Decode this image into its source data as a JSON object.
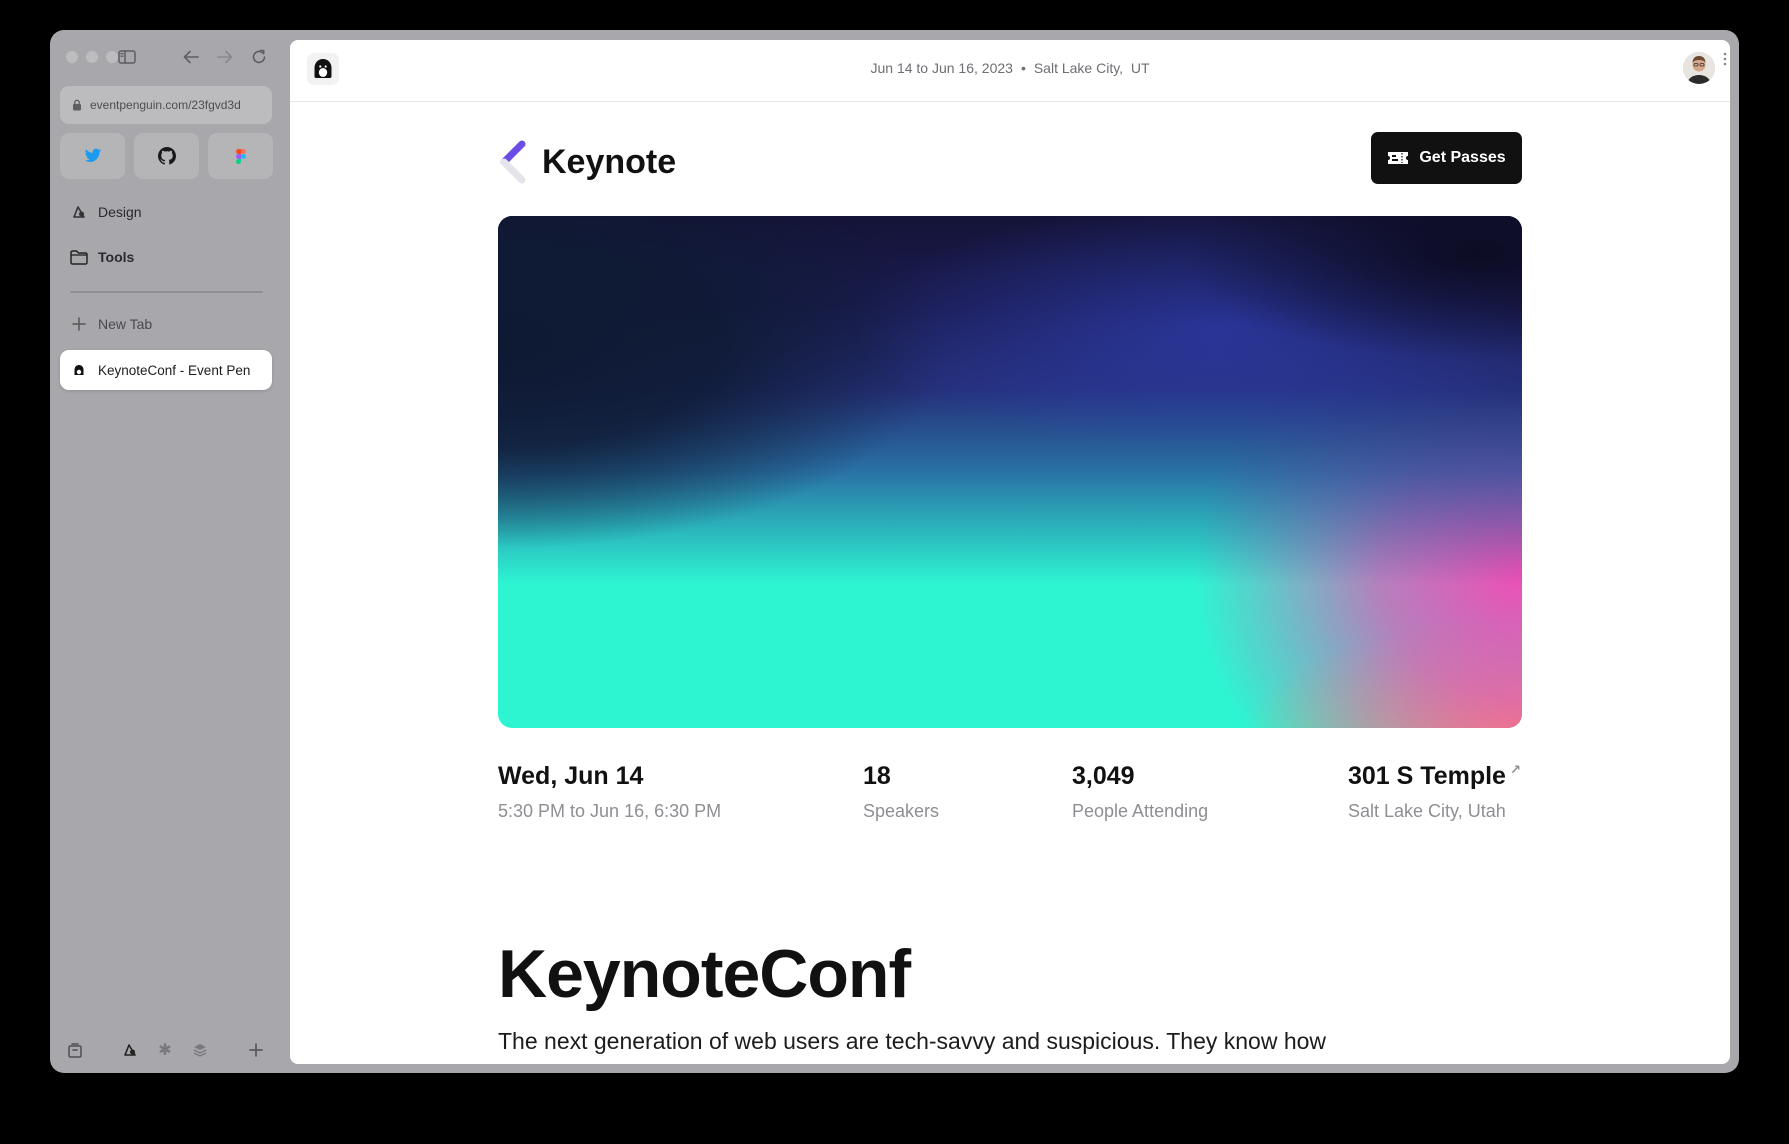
{
  "browser": {
    "url": "eventpenguin.com/23fgvd3d",
    "favorites": [
      {
        "name": "twitter-icon"
      },
      {
        "name": "github-icon"
      },
      {
        "name": "figma-icon"
      }
    ],
    "sidebar_items": [
      {
        "label": "Design",
        "icon": "design-icon"
      },
      {
        "label": "Tools",
        "icon": "folder-icon"
      }
    ],
    "new_tab_label": "New Tab",
    "active_tab_label": "KeynoteConf - Event Pen"
  },
  "page": {
    "event_dates": "Jun 14 to Jun 16, 2023",
    "event_location": "Salt Lake City,  UT",
    "brand_name": "Keynote",
    "get_passes_label": "Get Passes",
    "stats": [
      {
        "value": "Wed, Jun 14",
        "label": "5:30 PM to Jun 16, 6:30 PM"
      },
      {
        "value": "18",
        "label": "Speakers"
      },
      {
        "value": "3,049",
        "label": "People Attending"
      },
      {
        "value": "301 S Temple",
        "label": "Salt Lake City, Utah"
      }
    ],
    "title": "KeynoteConf",
    "description": "The next generation of web users are tech-savvy and suspicious. They know how"
  },
  "colors": {
    "accent": "#6b4de6",
    "button_bg": "#111111",
    "hero_teal": "#2df5d2",
    "hero_pink": "#e94fb8"
  }
}
